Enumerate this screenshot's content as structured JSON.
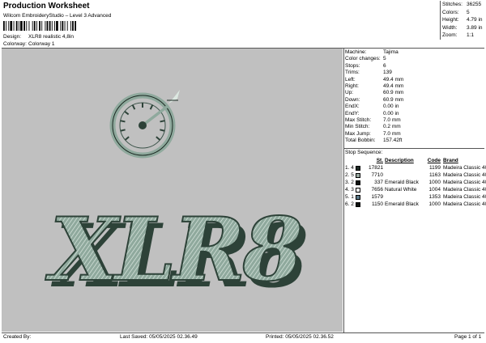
{
  "header": {
    "title": "Production Worksheet",
    "subtitle": "Wilcom EmbroideryStudio – Level 3 Advanced",
    "design_label": "Design:",
    "design_value": "XLR8 realistic 4,8in",
    "colorway_label": "Colorway:",
    "colorway_value": "Colorway 1"
  },
  "summary": [
    {
      "label": "Stitches:",
      "value": "36255"
    },
    {
      "label": "Colors:",
      "value": "5"
    },
    {
      "label": "Height:",
      "value": "4.79 in"
    },
    {
      "label": "Width:",
      "value": "3.89 in"
    },
    {
      "label": "Zoom:",
      "value": "1:1"
    }
  ],
  "info": [
    {
      "label": "Machine:",
      "value": "Tajima"
    },
    {
      "label": "Color changes:",
      "value": "5"
    },
    {
      "label": "Stops:",
      "value": "6"
    },
    {
      "label": "Trims:",
      "value": "139"
    },
    {
      "label": "Left:",
      "value": "49.4 mm"
    },
    {
      "label": "Right:",
      "value": "49.4 mm"
    },
    {
      "label": "Up:",
      "value": "60.9 mm"
    },
    {
      "label": "Down:",
      "value": "60.9 mm"
    },
    {
      "label": "EndX:",
      "value": "0.00 in"
    },
    {
      "label": "EndY:",
      "value": "0.00 in"
    },
    {
      "label": "Max Stitch:",
      "value": "7.0 mm"
    },
    {
      "label": "Min Stitch:",
      "value": "0.2 mm"
    },
    {
      "label": "Max Jump:",
      "value": "7.0 mm"
    },
    {
      "label": "Total Bobbin:",
      "value": "157.42ft"
    }
  ],
  "stop_sequence": {
    "title": "Stop Sequence:",
    "columns": {
      "st": "St.",
      "desc": "Description",
      "code": "Code",
      "brand": "Brand"
    },
    "rows": [
      {
        "num": "1.",
        "n": "4",
        "color": "#1e2a24",
        "st": "17821",
        "desc": "",
        "code": "1199",
        "brand": "Madeira Classic 40"
      },
      {
        "num": "2.",
        "n": "5",
        "color": "#98a8a0",
        "st": "7710",
        "desc": "",
        "code": "1163",
        "brand": "Madeira Classic 40"
      },
      {
        "num": "3.",
        "n": "2",
        "color": "#0e1210",
        "st": "337",
        "desc": "Emerald Black",
        "code": "1000",
        "brand": "Madeira Classic 40"
      },
      {
        "num": "4.",
        "n": "3",
        "color": "#f6f6f2",
        "st": "7656",
        "desc": "Natural White",
        "code": "1004",
        "brand": "Madeira Classic 40"
      },
      {
        "num": "5.",
        "n": "1",
        "color": "#5c7a8a",
        "st": "1579",
        "desc": "",
        "code": "1353",
        "brand": "Madeira Classic 40"
      },
      {
        "num": "6.",
        "n": "2",
        "color": "#0e1210",
        "st": "1150",
        "desc": "Emerald Black",
        "code": "1000",
        "brand": "Madeira Classic 40"
      }
    ]
  },
  "design": {
    "text": "XLR8",
    "main_color": "#8fa99d",
    "shadow_color": "#2d4238",
    "highlight_color": "#dce8e1"
  },
  "footer": {
    "created_by": "Created By:",
    "last_saved": "Last Saved: 05/05/2025 02.36.49",
    "printed": "Printed: 05/05/2025 02.36.52",
    "page": "Page 1 of 1"
  }
}
